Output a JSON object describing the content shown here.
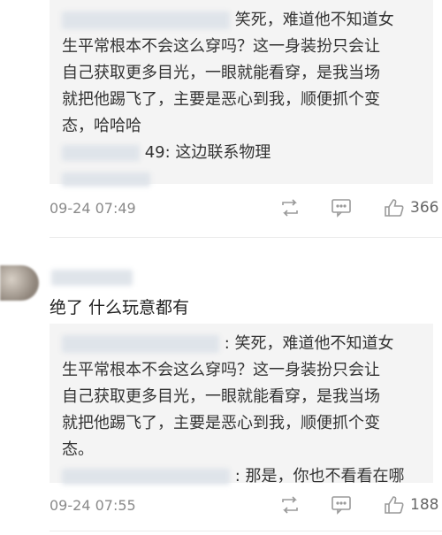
{
  "thread1": {
    "quote_lines": [
      "笑死，难道他不知道女",
      "生平常根本不会这么穿吗？这一身装扮只会让",
      "自己获取更多目光，一眼就能看穿，是我当场",
      "就把他踢飞了，主要是恶心到我，顺便抓个变",
      "态，哈哈哈"
    ],
    "reply_suffix": "49: 这边联系物理",
    "time": "09-24 07:49",
    "like_count": "366"
  },
  "thread2": {
    "comment_text": "绝了 什么玩意都有",
    "quote_lines": [
      ": 笑死，难道他不知道女",
      "生平常根本不会这么穿吗？这一身装扮只会让",
      "自己获取更多目光，一眼就能看穿，是我当场",
      "就把他踢飞了，主要是恶心到我，顺便抓个变",
      "态。"
    ],
    "reply_suffix": ": 那是，你也不看看在哪",
    "time": "09-24 07:55",
    "like_count": "188"
  },
  "icons": {
    "repost": "repost-icon",
    "comment": "comment-icon",
    "like": "thumbs-up-icon"
  },
  "colors": {
    "quote_bg": "#f4f4f4",
    "meta_text": "#8a8a8a"
  }
}
